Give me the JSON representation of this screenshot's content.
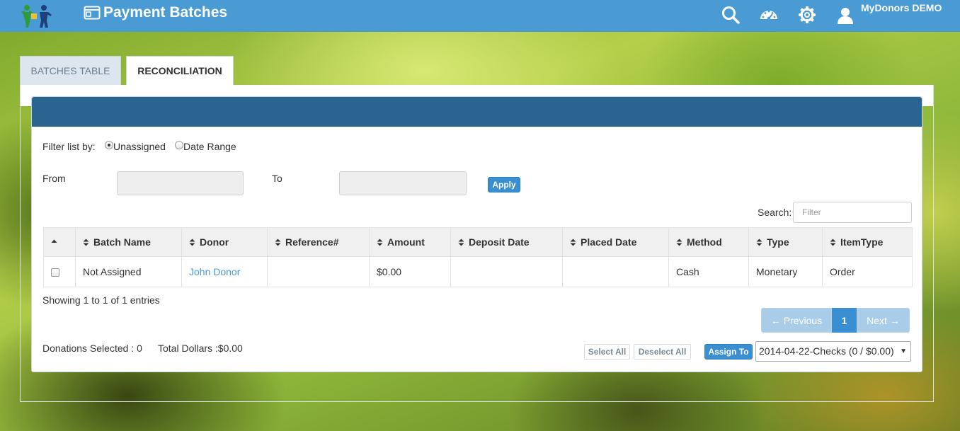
{
  "app": {
    "title": "Payment Batches",
    "user_name": "MyDonors DEMO"
  },
  "tabs": [
    {
      "label": "BATCHES TABLE",
      "active": false
    },
    {
      "label": "RECONCILIATION",
      "active": true
    }
  ],
  "filter": {
    "label": "Filter list by:",
    "options": [
      {
        "label": "Unassigned",
        "checked": true
      },
      {
        "label": "Date Range",
        "checked": false
      }
    ],
    "from_label": "From",
    "from_value": "",
    "to_label": "To",
    "to_value": "",
    "apply_label": "Apply"
  },
  "search": {
    "label": "Search:",
    "placeholder": "Filter"
  },
  "table": {
    "columns": [
      "",
      "Batch Name",
      "Donor",
      "Reference#",
      "Amount",
      "Deposit Date",
      "Placed Date",
      "Method",
      "Type",
      "ItemType"
    ],
    "rows": [
      {
        "checked": false,
        "batch_name": "Not Assigned",
        "donor": "John Donor",
        "reference": "",
        "amount": "$0.00",
        "deposit_date": "",
        "placed_date": "",
        "method": "Cash",
        "type": "Monetary",
        "item_type": "Order"
      }
    ]
  },
  "summary": {
    "showing": "Showing 1 to 1 of 1 entries",
    "donations_selected": "Donations Selected : 0",
    "total_dollars": "Total Dollars :$0.00"
  },
  "pagination": {
    "previous": "← Previous",
    "current": "1",
    "next": "Next →"
  },
  "actions": {
    "select_all": "Select All",
    "deselect_all": "Deselect All",
    "assign_to": "Assign To",
    "batch_select_value": "2014-04-22-Checks (0 / $0.00)"
  },
  "colors": {
    "topbar": "#4a9bd4",
    "card_header": "#2a6490",
    "accent": "#3a8fd2",
    "link": "#4a9bd4"
  }
}
